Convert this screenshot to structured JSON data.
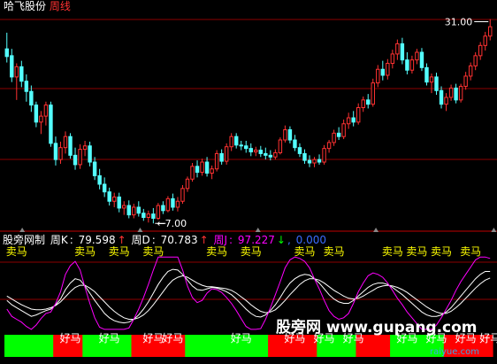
{
  "header": {
    "stock_name": "哈飞股份",
    "period": "周线"
  },
  "indicator": {
    "title": "股旁网制",
    "k_label": "周K",
    "k_value": "79.598",
    "k_arrow": "↑",
    "d_label": "周D",
    "d_value": "70.783",
    "d_arrow": "↑",
    "j_label": "周J",
    "j_value": "97.227",
    "j_arrow": "↓",
    "extra_value": "0.000"
  },
  "watermark": {
    "text": "股旁网 www.gupang.com",
    "sub": "raiyue.com"
  },
  "colors": {
    "background": "#000000",
    "up_candle": "#ff3232",
    "down_candle": "#54ffff",
    "k_line": "#ffffff",
    "d_line": "#ffffff",
    "j_line": "#ff00ff",
    "sell_text": "#ffff00",
    "buy_text": "#ffffff",
    "bar_green": "#00ff00",
    "bar_red": "#ff0000",
    "grid": "#8b0000",
    "title_color": "#ffffff",
    "period_color": "#ff3232"
  },
  "chart_data": [
    {
      "type": "candlestick",
      "title": "哈飞股份 周线",
      "annotations": [
        {
          "text": "31.00",
          "x_index": 99,
          "price": 31.0
        },
        {
          "text": "7.00",
          "x_index": 30,
          "price": 7.0
        }
      ],
      "ylim": [
        6.4,
        32.2
      ],
      "candles": [
        [
          27.5,
          29.4,
          25.9,
          26.6
        ],
        [
          26.7,
          27.5,
          23.6,
          24.2
        ],
        [
          24.2,
          25.8,
          21.5,
          25.4
        ],
        [
          25.4,
          26.1,
          23.0,
          23.7
        ],
        [
          23.7,
          24.5,
          21.3,
          22.5
        ],
        [
          22.5,
          23.2,
          20.1,
          20.9
        ],
        [
          20.9,
          21.3,
          18.3,
          18.9
        ],
        [
          18.9,
          20.2,
          17.5,
          19.6
        ],
        [
          19.6,
          21.3,
          18.5,
          20.9
        ],
        [
          20.9,
          21.3,
          16.0,
          16.4
        ],
        [
          16.4,
          17.2,
          13.8,
          14.5
        ],
        [
          14.5,
          16.6,
          14.0,
          15.9
        ],
        [
          15.9,
          17.8,
          15.2,
          17.2
        ],
        [
          17.2,
          17.6,
          14.6,
          15.0
        ],
        [
          15.0,
          15.9,
          13.3,
          13.9
        ],
        [
          13.9,
          16.3,
          13.4,
          15.7
        ],
        [
          15.7,
          16.7,
          14.9,
          16.1
        ],
        [
          16.1,
          16.6,
          13.7,
          14.2
        ],
        [
          14.2,
          14.8,
          12.1,
          12.6
        ],
        [
          12.6,
          13.4,
          11.0,
          11.6
        ],
        [
          11.6,
          12.4,
          10.1,
          10.7
        ],
        [
          10.7,
          11.2,
          9.1,
          9.6
        ],
        [
          9.6,
          10.6,
          8.9,
          10.1
        ],
        [
          10.1,
          10.6,
          8.3,
          8.8
        ],
        [
          8.8,
          9.6,
          8.0,
          9.1
        ],
        [
          9.1,
          9.7,
          7.6,
          8.0
        ],
        [
          8.0,
          9.3,
          7.6,
          8.9
        ],
        [
          8.9,
          9.6,
          7.8,
          8.2
        ],
        [
          8.2,
          8.7,
          7.3,
          7.7
        ],
        [
          7.7,
          8.5,
          7.1,
          8.1
        ],
        [
          8.1,
          8.8,
          7.0,
          7.6
        ],
        [
          7.6,
          9.4,
          7.4,
          9.1
        ],
        [
          9.1,
          9.6,
          8.1,
          8.5
        ],
        [
          8.5,
          10.2,
          8.3,
          9.9
        ],
        [
          9.9,
          10.5,
          8.5,
          8.9
        ],
        [
          8.9,
          10.1,
          8.4,
          9.6
        ],
        [
          9.6,
          11.5,
          9.3,
          11.1
        ],
        [
          11.1,
          12.5,
          10.7,
          12.2
        ],
        [
          12.2,
          14.1,
          11.9,
          13.7
        ],
        [
          13.7,
          14.4,
          12.4,
          13.0
        ],
        [
          13.0,
          14.6,
          12.6,
          14.2
        ],
        [
          14.2,
          14.8,
          12.5,
          12.9
        ],
        [
          12.9,
          13.8,
          12.2,
          13.4
        ],
        [
          13.4,
          15.6,
          13.1,
          15.2
        ],
        [
          15.2,
          15.7,
          13.9,
          14.3
        ],
        [
          14.3,
          16.4,
          13.9,
          16.0
        ],
        [
          16.0,
          17.6,
          15.5,
          17.2
        ],
        [
          17.2,
          17.6,
          15.8,
          16.2
        ],
        [
          16.2,
          16.7,
          15.6,
          16.1
        ],
        [
          16.1,
          16.7,
          15.3,
          15.8
        ],
        [
          15.8,
          16.4,
          14.9,
          15.4
        ],
        [
          15.4,
          16.0,
          14.9,
          15.6
        ],
        [
          15.6,
          16.1,
          14.8,
          15.2
        ],
        [
          15.2,
          15.9,
          14.5,
          15.0
        ],
        [
          15.0,
          15.6,
          14.4,
          14.8
        ],
        [
          14.8,
          15.7,
          14.5,
          15.3
        ],
        [
          15.3,
          17.1,
          15.1,
          16.8
        ],
        [
          16.8,
          18.5,
          16.5,
          18.0
        ],
        [
          18.0,
          18.4,
          16.4,
          16.8
        ],
        [
          16.8,
          17.4,
          15.5,
          15.9
        ],
        [
          15.9,
          16.4,
          14.8,
          15.2
        ],
        [
          15.2,
          15.7,
          14.0,
          14.4
        ],
        [
          14.4,
          15.0,
          13.6,
          14.1
        ],
        [
          14.1,
          14.8,
          13.6,
          14.5
        ],
        [
          14.5,
          15.1,
          13.9,
          14.2
        ],
        [
          14.2,
          16.2,
          13.9,
          15.8
        ],
        [
          15.8,
          16.8,
          15.3,
          16.5
        ],
        [
          16.5,
          18.0,
          16.1,
          17.6
        ],
        [
          17.6,
          18.3,
          16.8,
          17.2
        ],
        [
          17.2,
          19.2,
          16.9,
          18.7
        ],
        [
          18.7,
          20.0,
          18.1,
          19.4
        ],
        [
          19.4,
          20.2,
          18.4,
          18.9
        ],
        [
          18.9,
          21.1,
          18.6,
          20.6
        ],
        [
          20.6,
          21.9,
          20.1,
          21.5
        ],
        [
          21.5,
          22.2,
          20.5,
          21.0
        ],
        [
          21.0,
          24.0,
          20.7,
          23.5
        ],
        [
          23.5,
          25.6,
          23.0,
          25.1
        ],
        [
          25.1,
          26.1,
          23.8,
          24.4
        ],
        [
          24.4,
          26.3,
          23.9,
          25.8
        ],
        [
          25.8,
          27.4,
          25.2,
          26.9
        ],
        [
          26.9,
          28.6,
          26.2,
          28.1
        ],
        [
          28.1,
          28.8,
          25.7,
          26.2
        ],
        [
          26.2,
          27.1,
          24.5,
          25.0
        ],
        [
          25.0,
          26.7,
          24.6,
          26.2
        ],
        [
          26.2,
          27.5,
          25.7,
          27.1
        ],
        [
          27.1,
          27.6,
          24.9,
          25.3
        ],
        [
          25.3,
          25.8,
          23.2,
          23.6
        ],
        [
          23.6,
          24.6,
          22.3,
          24.2
        ],
        [
          24.2,
          24.7,
          22.1,
          22.6
        ],
        [
          22.6,
          23.1,
          20.5,
          21.0
        ],
        [
          21.0,
          22.3,
          20.2,
          21.8
        ],
        [
          21.8,
          23.3,
          21.4,
          22.9
        ],
        [
          22.9,
          23.4,
          21.1,
          21.5
        ],
        [
          21.5,
          23.4,
          21.2,
          23.1
        ],
        [
          23.1,
          24.8,
          22.7,
          24.3
        ],
        [
          24.3,
          25.9,
          23.8,
          25.5
        ],
        [
          25.5,
          27.1,
          25.0,
          26.7
        ],
        [
          26.7,
          28.3,
          26.2,
          27.9
        ],
        [
          27.9,
          29.5,
          27.3,
          29.0
        ],
        [
          29.0,
          31.0,
          28.5,
          30.1
        ]
      ]
    },
    {
      "type": "line",
      "title": "股旁网制",
      "series": [
        {
          "name": "周K",
          "values": [
            40,
            34,
            30,
            26,
            22,
            18,
            20,
            23,
            26,
            28,
            34,
            42,
            55,
            64,
            70,
            68,
            60,
            50,
            40,
            31,
            22,
            16,
            12,
            10,
            9,
            10,
            14,
            20,
            28,
            38,
            50,
            62,
            72,
            80,
            83,
            82,
            76,
            68,
            60,
            55,
            54,
            56,
            58,
            57,
            55,
            52,
            48,
            42,
            35,
            28,
            22,
            18,
            17,
            20,
            26,
            34,
            44,
            55,
            64,
            70,
            74,
            76,
            75,
            70,
            64,
            56,
            48,
            42,
            38,
            36,
            36,
            40,
            46,
            52,
            58,
            62,
            64,
            64,
            62,
            58,
            53,
            48,
            42,
            36,
            30,
            24,
            20,
            18,
            18,
            20,
            24,
            30,
            38,
            46,
            54,
            62,
            70,
            76,
            80,
            80
          ]
        },
        {
          "name": "周D",
          "values": [
            46,
            42,
            38,
            34,
            31,
            28,
            27,
            27,
            28,
            30,
            33,
            38,
            45,
            52,
            58,
            61,
            61,
            57,
            52,
            45,
            38,
            31,
            25,
            20,
            16,
            14,
            14,
            16,
            20,
            26,
            34,
            43,
            52,
            61,
            68,
            72,
            74,
            72,
            68,
            64,
            61,
            59,
            59,
            58,
            57,
            56,
            54,
            50,
            45,
            40,
            34,
            29,
            25,
            23,
            24,
            27,
            33,
            40,
            48,
            55,
            62,
            67,
            70,
            70,
            68,
            64,
            59,
            54,
            50,
            46,
            43,
            42,
            43,
            46,
            50,
            54,
            58,
            60,
            61,
            60,
            58,
            55,
            51,
            46,
            41,
            36,
            31,
            27,
            24,
            22,
            22,
            25,
            30,
            36,
            43,
            50,
            57,
            63,
            68,
            71
          ]
        },
        {
          "name": "周J",
          "values": [
            28,
            18,
            14,
            10,
            4,
            0,
            6,
            15,
            22,
            24,
            36,
            52,
            76,
            88,
            94,
            82,
            58,
            36,
            16,
            3,
            0,
            0,
            0,
            0,
            0,
            2,
            14,
            28,
            44,
            62,
            82,
            100,
            100,
            100,
            100,
            100,
            82,
            60,
            44,
            37,
            40,
            50,
            56,
            55,
            51,
            44,
            36,
            26,
            15,
            4,
            0,
            0,
            1,
            14,
            30,
            48,
            66,
            85,
            96,
            100,
            98,
            94,
            85,
            70,
            56,
            40,
            26,
            18,
            14,
            16,
            22,
            36,
            52,
            64,
            74,
            78,
            76,
            72,
            64,
            54,
            43,
            34,
            24,
            16,
            8,
            0,
            0,
            0,
            6,
            16,
            28,
            40,
            54,
            66,
            76,
            86,
            96,
            100,
            100,
            98
          ]
        }
      ],
      "sell_signals": [
        {
          "label": "卖马",
          "x_index": 2
        },
        {
          "label": "卖马",
          "x_index": 16
        },
        {
          "label": "卖马",
          "x_index": 23
        },
        {
          "label": "卖马",
          "x_index": 30
        },
        {
          "label": "卖马",
          "x_index": 43
        },
        {
          "label": "卖马",
          "x_index": 50
        },
        {
          "label": "卖马",
          "x_index": 61
        },
        {
          "label": "卖马",
          "x_index": 67
        },
        {
          "label": "卖马",
          "x_index": 79
        },
        {
          "label": "卖马",
          "x_index": 84
        },
        {
          "label": "卖马",
          "x_index": 89
        },
        {
          "label": "卖马",
          "x_index": 95
        }
      ],
      "buy_signals": [
        {
          "label": "好马",
          "x_index": 13
        },
        {
          "label": "好马",
          "x_index": 21
        },
        {
          "label": "好马",
          "x_index": 30
        },
        {
          "label": "好马",
          "x_index": 34
        },
        {
          "label": "好马",
          "x_index": 48
        },
        {
          "label": "好马",
          "x_index": 59
        },
        {
          "label": "好马",
          "x_index": 65
        },
        {
          "label": "好马",
          "x_index": 71
        },
        {
          "label": "好马",
          "x_index": 82
        },
        {
          "label": "好马",
          "x_index": 88
        },
        {
          "label": "好马",
          "x_index": 94
        },
        {
          "label": "好马",
          "x_index": 99
        }
      ],
      "ylim": [
        -5,
        110
      ]
    }
  ]
}
